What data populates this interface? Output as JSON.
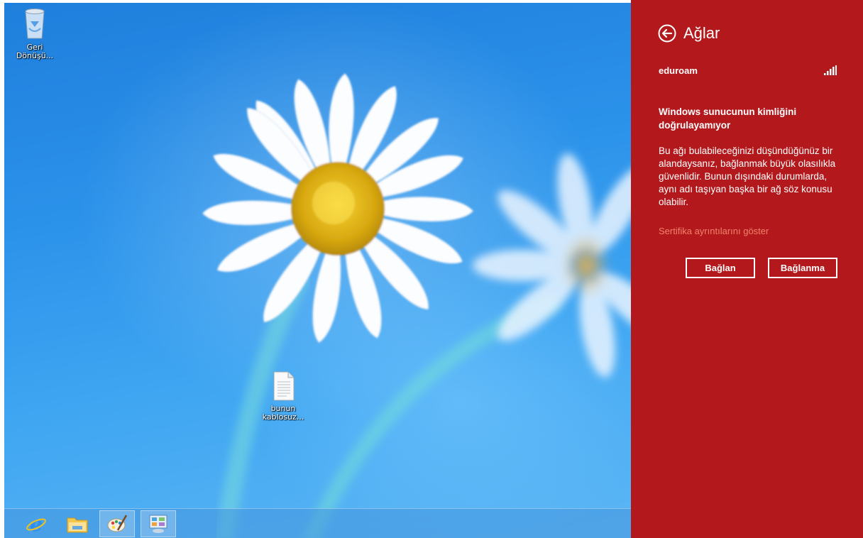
{
  "desktop": {
    "icons": [
      {
        "name": "recycle-bin",
        "label": "Geri Dönüşü..."
      },
      {
        "name": "text-document",
        "label": "bunun kablosuz..."
      }
    ]
  },
  "taskbar": {
    "items": [
      "internet-explorer-icon",
      "file-explorer-icon",
      "paint-icon",
      "control-panel-icon"
    ]
  },
  "charm": {
    "title": "Ağlar",
    "network_name": "eduroam",
    "signal_icon": "wifi-signal-icon",
    "warning_title": "Windows sunucunun kimliğini doğrulayamıyor",
    "warning_body": "Bu ağı bulabileceğinizi düşündüğünüz bir alandaysanız, bağlanmak büyük olasılıkla güvenlidir. Bunun dışındaki durumlarda, aynı adı taşıyan başka bir ağ söz konusu olabilir.",
    "cert_link": "Sertifika ayrıntılarını göster",
    "connect_label": "Bağlan",
    "dont_connect_label": "Bağlanma"
  },
  "colors": {
    "charm_background": "#b3191c",
    "link": "#f0826a",
    "desktop_blue": "#2b92ea"
  }
}
